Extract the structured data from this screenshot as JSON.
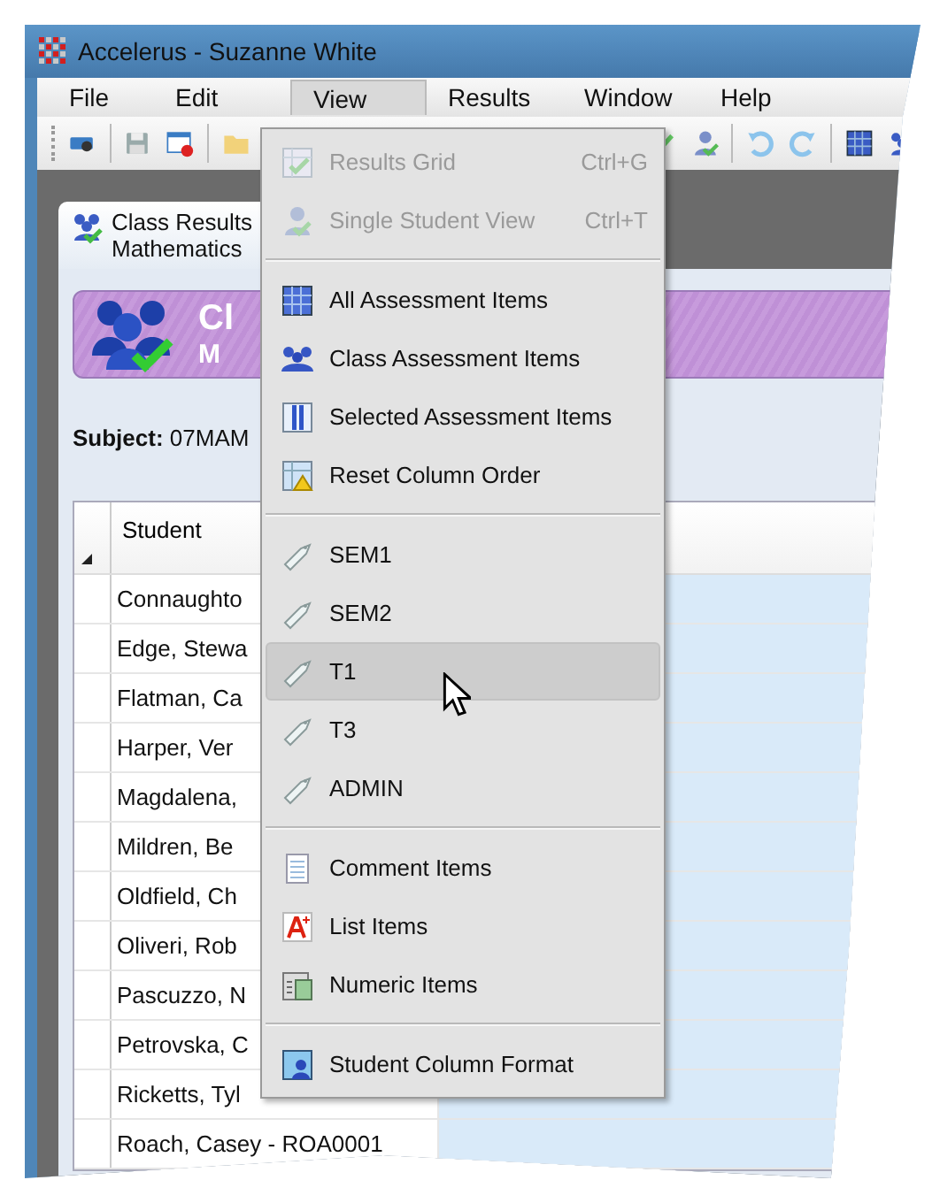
{
  "window": {
    "title": "Accelerus - Suzanne White"
  },
  "menu_bar": [
    {
      "label": "File",
      "selected": false
    },
    {
      "label": "Edit",
      "selected": false
    },
    {
      "label": "View",
      "selected": true
    },
    {
      "label": "Results",
      "selected": false
    },
    {
      "label": "Window",
      "selected": false
    },
    {
      "label": "Help",
      "selected": false
    }
  ],
  "document_tab": {
    "title": "Class Results",
    "subtitle": "Mathematics"
  },
  "header": {
    "title": "Cl",
    "subtitle": "M"
  },
  "subject": "**Subject:** 07MAM",
  "table": {
    "columns": [
      "Student"
    ],
    "rows": [
      "Connaughto",
      "Edge, Stewa",
      "Flatman, Ca",
      "Harper, Ver",
      "Magdalena,",
      "Mildren, Be",
      "Oldfield, Ch",
      "Oliveri, Rob",
      "Pascuzzo, N",
      "Petrovska, C",
      "Ricketts, Tyl",
      "Roach, Casey - ROA0001"
    ]
  },
  "view_menu": [
    [
      {
        "kind": "grid",
        "label": "Results Grid",
        "shortcut": "Ctrl+G",
        "disabled": true,
        "highlighted": false
      },
      {
        "kind": "student",
        "label": "Single Student View",
        "shortcut": "Ctrl+T",
        "disabled": true,
        "highlighted": false
      }
    ],
    [
      {
        "kind": "all",
        "label": "All Assessment Items",
        "disabled": false,
        "highlighted": false
      },
      {
        "kind": "class",
        "label": "Class Assessment Items",
        "disabled": false,
        "highlighted": false
      },
      {
        "kind": "selected",
        "label": "Selected Assessment Items",
        "disabled": false,
        "highlighted": false
      },
      {
        "kind": "reset",
        "label": "Reset Column Order",
        "disabled": false,
        "highlighted": false
      }
    ],
    [
      {
        "kind": "tag",
        "label": "SEM1",
        "disabled": false,
        "highlighted": false
      },
      {
        "kind": "tag",
        "label": "SEM2",
        "disabled": false,
        "highlighted": false
      },
      {
        "kind": "tag",
        "label": "T1",
        "disabled": false,
        "highlighted": true
      },
      {
        "kind": "tag",
        "label": "T3",
        "disabled": false,
        "highlighted": false
      },
      {
        "kind": "tag",
        "label": "ADMIN",
        "disabled": false,
        "highlighted": false
      }
    ],
    [
      {
        "kind": "comment",
        "label": "Comment Items",
        "disabled": false,
        "highlighted": false
      },
      {
        "kind": "list",
        "label": "List Items",
        "disabled": false,
        "highlighted": false
      },
      {
        "kind": "numeric",
        "label": "Numeric Items",
        "disabled": false,
        "highlighted": false
      }
    ],
    [
      {
        "kind": "format",
        "label": "Student Column Format",
        "disabled": false,
        "highlighted": false
      }
    ]
  ]
}
